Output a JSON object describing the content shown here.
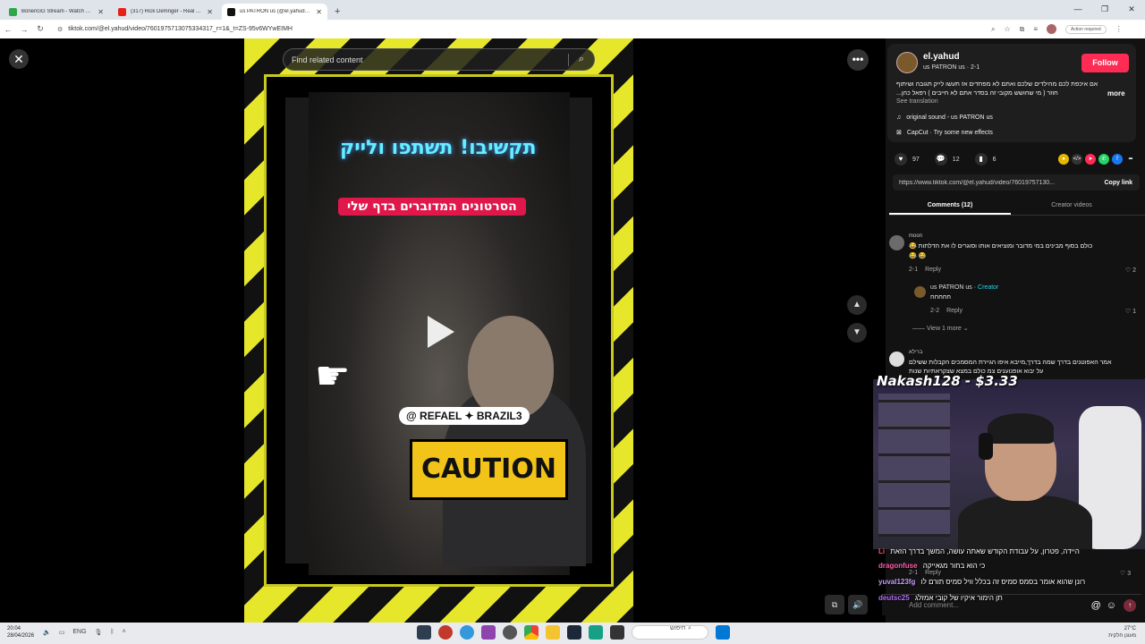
{
  "browser": {
    "tabs": [
      {
        "title": "BonenGG Stream - Watch Live -",
        "color": "#2ea84a"
      },
      {
        "title": "(317) Rick Demnger - Real Am",
        "color": "#e62117"
      },
      {
        "title": "us PATRON us (@el.yahud) | Ti",
        "color": "#111111"
      }
    ],
    "url": "tiktok.com/@el.yahud/video/7601975713075334317_r=1&_t=ZS-95v6WYwEIMH",
    "action_required": "Action required"
  },
  "video": {
    "search_placeholder": "Find related content",
    "title_line1": "תקשיבו! תשתפו ולייק",
    "title_line2": "הסרטונים המדוברים בדף שלי",
    "handle": "@ REFAEL ✦ BRAZIL3",
    "caution": "CAUTION"
  },
  "author": {
    "name": "el.yahud",
    "subtitle": "us PATRON us · 2-1",
    "follow_label": "Follow",
    "caption": "אם איכפת לכם מהילדים שלכם ואתם לא מפחדים אז תעשו לייק תגובה ושיתוף חוזר ( מי שחושש מקובי זה בסדר אתם לא חייבים ) רפאל כהן...",
    "more_label": "more",
    "see_translation": "See translation",
    "sound": "original sound - us PATRON us",
    "effect": "CapCut · Try some new effects"
  },
  "actions": {
    "likes": "97",
    "comments": "12",
    "saves": "6"
  },
  "link": {
    "url": "https://www.tiktok.com/@el.yahud/video/76019757130...",
    "copy_label": "Copy link"
  },
  "tabs": {
    "comments": "Comments (12)",
    "creator": "Creator videos"
  },
  "comments": [
    {
      "user": "moon",
      "text": "כולם בסוף מבינים במי מדובר ומוציאים אותו וסוגרים לו את הדלתות 😂",
      "emoji": "😂 😂",
      "date": "2-1",
      "reply": "Reply",
      "likes": "2"
    },
    {
      "user": "us PATRON us",
      "creator": "Creator",
      "text": "חחחחח",
      "date": "2-2",
      "reply": "Reply",
      "likes": "1"
    },
    {
      "user": "ברילא",
      "text": "אמר האפוטנים בדרך שמה בדרך,מייבא איפו הגיירת המסמכים הקבלות ששילם על יבוא אופנוענים צמ כולם במצא שצקראתיות שנות",
      "date": "2-1",
      "reply": "Reply",
      "likes": "3"
    }
  ],
  "view_more": "View 1 more",
  "stream": {
    "title": "Nakash128 - $3.33",
    "chat": [
      {
        "user": "Li",
        "text": "היידה, פטרון, על עבודת הקודש שאתה עושה, המשך בדרך הזאת",
        "color": "#ff4d6a"
      },
      {
        "user": "dragonfuse",
        "text": "כי הוא בחור מגאייקה",
        "color": "#ff5ca8"
      },
      {
        "user": "yuval123fg",
        "text": "רונן שהוא אומר בסמס סמיס זה בכלל וויל סמיס תורם לו",
        "color": "#c79bff"
      },
      {
        "user": "deutsc25",
        "text": "תן הימור איקיו של קובי אמזלג",
        "color": "#b36bff"
      }
    ]
  },
  "add_comment_placeholder": "Add comment...",
  "taskbar": {
    "time": "20:04",
    "date": "28/04/2026",
    "lang": "ENG",
    "search": "חיפוש",
    "weather_temp": "27°C",
    "weather_text": "מעונן חלקית"
  }
}
